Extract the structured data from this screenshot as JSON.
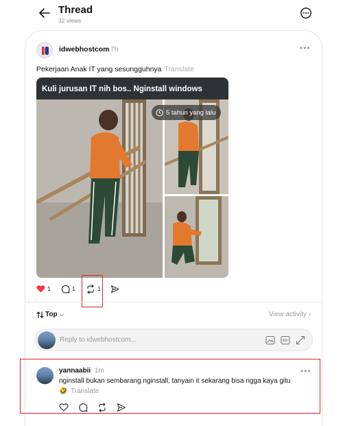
{
  "header": {
    "title": "Thread",
    "views": "32 views",
    "back_icon": "arrow-left-icon",
    "more_icon": "more-circle-icon"
  },
  "post": {
    "username": "idwebhostcom",
    "time": "7h",
    "text": "Pekerjaan Anak IT yang sesungguhnya",
    "translate_label": "Translate",
    "media": {
      "caption": "Kuli jurusan IT nih bos.. Nginstall windows",
      "time_chip": "5 tahun yang lalu"
    },
    "actions": {
      "like_count": "1",
      "comment_count": "1",
      "repost_count": "1"
    }
  },
  "sort": {
    "label": "Top",
    "view_activity": "View activity"
  },
  "reply": {
    "placeholder": "Reply to idwebhostcom..."
  },
  "comment": {
    "username": "yannaabii",
    "time": "1m",
    "text": "nginstall bukan sembarang nginstall, tanyain it sekarang bisa ngga kaya gitu",
    "emoji": "🤣",
    "translate_label": "Translate"
  },
  "colors": {
    "like": "#ff3040",
    "highlight": "#e02020",
    "caption_bg": "#2f3235"
  }
}
